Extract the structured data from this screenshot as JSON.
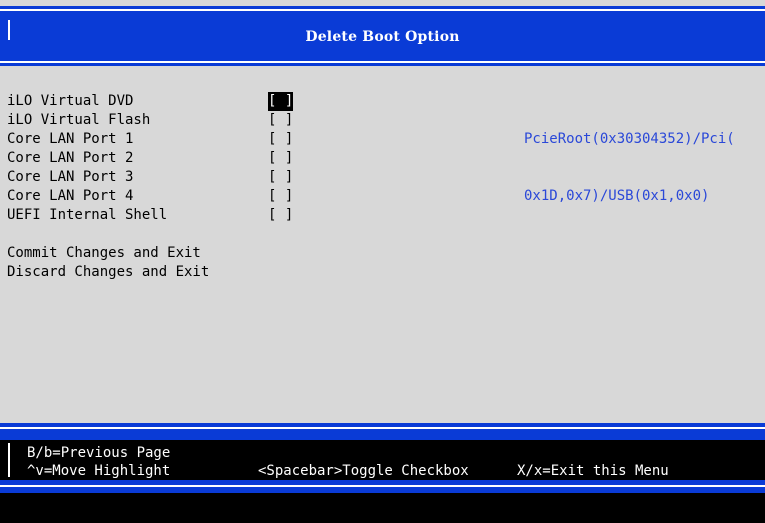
{
  "header": {
    "title": "Delete Boot Option"
  },
  "boot_options": [
    {
      "label": "iLO Virtual DVD",
      "checkbox": "[ ]",
      "selected": true
    },
    {
      "label": "iLO Virtual Flash",
      "checkbox": "[ ]",
      "selected": false
    },
    {
      "label": "Core LAN Port 1",
      "checkbox": "[ ]",
      "selected": false
    },
    {
      "label": "Core LAN Port 2",
      "checkbox": "[ ]",
      "selected": false
    },
    {
      "label": "Core LAN Port 3",
      "checkbox": "[ ]",
      "selected": false
    },
    {
      "label": "Core LAN Port 4",
      "checkbox": "[ ]",
      "selected": false
    },
    {
      "label": "UEFI Internal Shell",
      "checkbox": "[ ]",
      "selected": false
    }
  ],
  "actions": {
    "commit": "Commit Changes and Exit",
    "discard": "Discard Changes and Exit"
  },
  "device_path": {
    "line1": "PcieRoot(0x30304352)/Pci(",
    "line2": "0x1D,0x7)/USB(0x1,0x0)"
  },
  "footer": {
    "prev_page": "B/b=Previous Page",
    "move_highlight": "^v=Move Highlight",
    "toggle": "<Spacebar>Toggle Checkbox",
    "exit": "X/x=Exit this Menu"
  },
  "colors": {
    "band": "#0a3bd6",
    "background": "#d8d8d8",
    "path_text": "#2a48d8"
  }
}
